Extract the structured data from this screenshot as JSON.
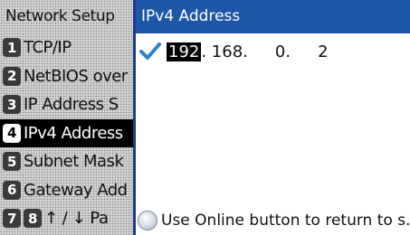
{
  "left_panel": {
    "title": "Network Setup",
    "items": [
      {
        "num": "1",
        "label": "TCP/IP"
      },
      {
        "num": "2",
        "label": "NetBIOS over"
      },
      {
        "num": "3",
        "label": "IP Address S"
      },
      {
        "num": "4",
        "label": "IPv4 Address"
      },
      {
        "num": "5",
        "label": "Subnet Mask"
      },
      {
        "num": "6",
        "label": "Gateway Add"
      }
    ],
    "paging": {
      "num_a": "7",
      "num_b": "8",
      "label": "↑ / ↓ Pa"
    }
  },
  "right_panel": {
    "title": "IPv4 Address",
    "octets": [
      "192",
      ". 168.",
      "0.",
      "2"
    ],
    "hint": "Use Online button to return to s..."
  },
  "colors": {
    "title_bar": "#1f57a8",
    "divider": "#1a3b8f",
    "check": "#2f7fd0"
  }
}
